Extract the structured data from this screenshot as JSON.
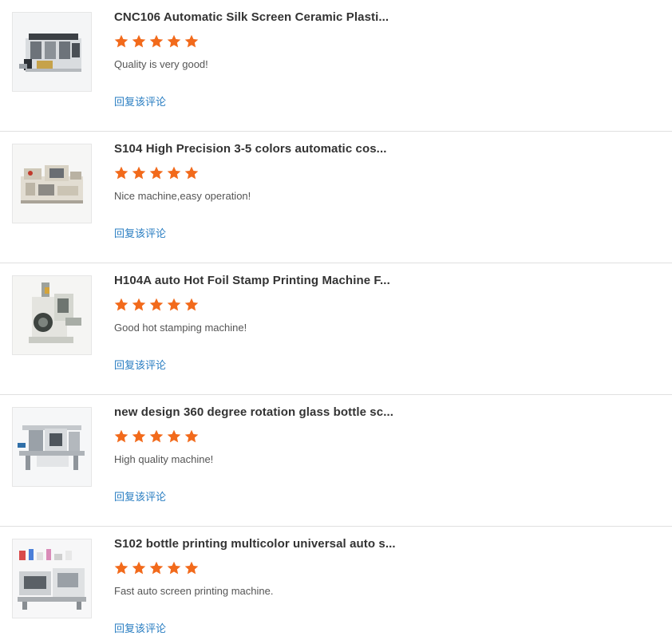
{
  "colors": {
    "star": "#f26a1b",
    "link": "#2a7ec2",
    "title": "#333333",
    "comment": "#555555",
    "divider": "#e0e0e0"
  },
  "reviews": [
    {
      "product_title": "CNC106 Automatic Silk Screen Ceramic Plasti...",
      "rating": 5,
      "comment": "Quality is very good!",
      "reply_label": "回复该评论",
      "thumbnail_icon": "silk-screen-machine-photo"
    },
    {
      "product_title": "S104 High Precision 3-5 colors automatic cos...",
      "rating": 5,
      "comment": "Nice machine,easy operation!",
      "reply_label": "回复该评论",
      "thumbnail_icon": "multicolor-printer-photo"
    },
    {
      "product_title": "H104A auto Hot Foil Stamp Printing Machine F...",
      "rating": 5,
      "comment": "Good hot stamping machine!",
      "reply_label": "回复该评论",
      "thumbnail_icon": "hot-foil-stamping-machine-photo"
    },
    {
      "product_title": "new design 360 degree rotation glass bottle sc...",
      "rating": 5,
      "comment": "High quality machine!",
      "reply_label": "回复该评论",
      "thumbnail_icon": "bottle-printer-photo"
    },
    {
      "product_title": "S102 bottle printing multicolor universal auto s...",
      "rating": 5,
      "comment": "Fast auto screen printing machine.",
      "reply_label": "回复该评论",
      "thumbnail_icon": "universal-screen-printer-photo"
    }
  ]
}
